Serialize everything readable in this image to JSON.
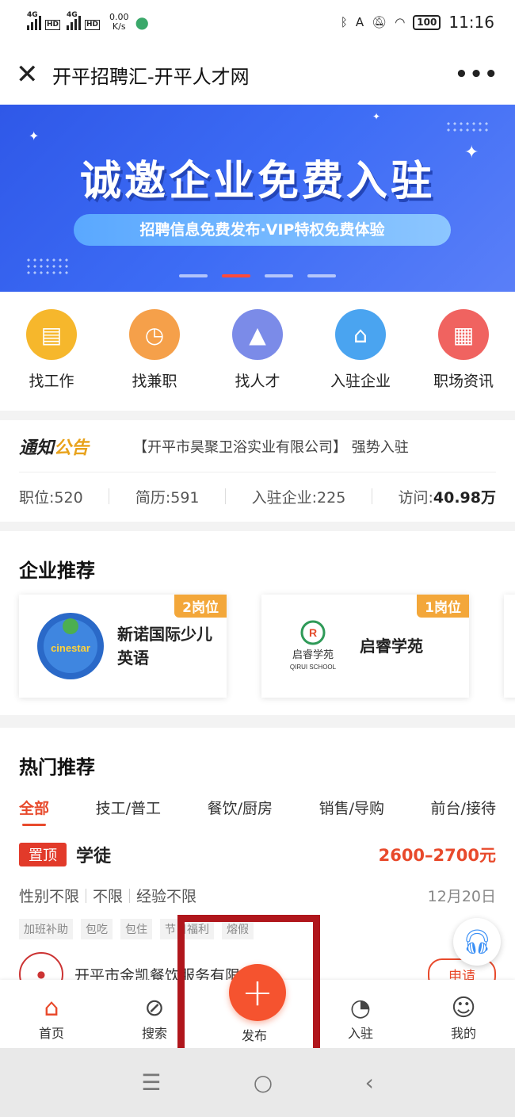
{
  "status_bar": {
    "speed_value": "0.00",
    "speed_unit": "K/s",
    "net1": "4G",
    "net2": "4G",
    "hd": "HD",
    "battery": "100",
    "time": "11:16"
  },
  "title_bar": {
    "title": "开平招聘汇-开平人才网",
    "more": "•••"
  },
  "banner": {
    "headline": "诚邀企业免费入驻",
    "subline": "招聘信息免费发布·VIP特权免费体验",
    "active_slide": 2,
    "slide_count": 4
  },
  "quick_links": [
    {
      "label": "找工作",
      "icon": "briefcase-icon",
      "color": "#f6b72c"
    },
    {
      "label": "找兼职",
      "icon": "clock-icon",
      "color": "#f5a04a"
    },
    {
      "label": "找人才",
      "icon": "graduation-cap-icon",
      "color": "#7b8be8"
    },
    {
      "label": "入驻企业",
      "icon": "shop-icon",
      "color": "#4aa4f0"
    },
    {
      "label": "职场资讯",
      "icon": "document-icon",
      "color": "#f06360"
    }
  ],
  "notice": {
    "badge_a": "通知",
    "badge_b": "公告",
    "text": "【开平市昊聚卫浴实业有限公司】 强势入驻"
  },
  "stats": {
    "positions": "职位:520",
    "resumes": "简历:591",
    "companies": "入驻企业:225",
    "visits_label": "访问:",
    "visits_value": "40.98万"
  },
  "enterprise": {
    "title": "企业推荐",
    "items": [
      {
        "name": "新诺国际少儿英语",
        "badge": "2岗位",
        "logo_text": "cinestar"
      },
      {
        "name": "启睿学苑",
        "badge": "1岗位",
        "logo_text": "启睿学苑",
        "logo_sub": "QIRUI SCHOOL"
      }
    ]
  },
  "hot": {
    "title": "热门推荐",
    "tabs": [
      "全部",
      "技工/普工",
      "餐饮/厨房",
      "销售/导购",
      "前台/接待"
    ],
    "job": {
      "top_badge": "置顶",
      "title": "学徒",
      "salary": "2600–2700元",
      "gender": "性别不限",
      "education": "不限",
      "experience": "经验不限",
      "date": "12月20日",
      "perks": [
        "加班补助",
        "包吃",
        "包住",
        "节日福利",
        "熔假"
      ]
    },
    "job2": {
      "company": "开平市金凯餐饮服务有限",
      "apply": "申请"
    }
  },
  "tabbar": {
    "home": "首页",
    "search": "搜索",
    "publish": "发布",
    "join": "入驻",
    "mine": "我的"
  },
  "nav": {
    "menu": "☰",
    "home": "○",
    "back": "‹"
  }
}
